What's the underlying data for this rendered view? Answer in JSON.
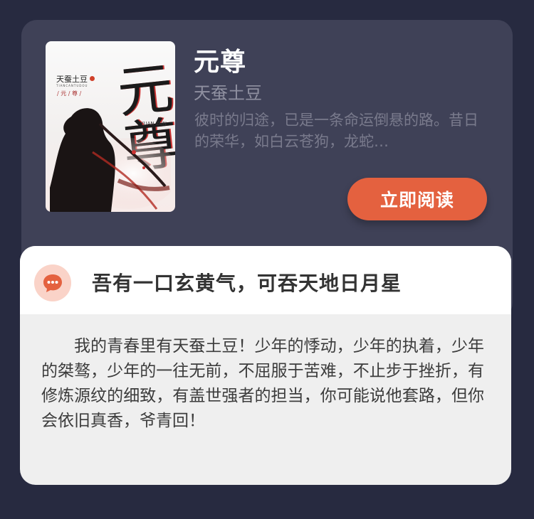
{
  "book": {
    "title": "元尊",
    "author": "天蚕土豆",
    "description": "彼时的归途，已是一条命运倒悬的路。昔日的荣华，如白云苍狗，龙蛇…",
    "read_button": "立即阅读",
    "cover": {
      "author": "天蚕土豆",
      "tag": "/ 元 / 尊 /",
      "calligraphy": "元尊",
      "pinyin": "YUAN ZUN",
      "subtitle": "TIANCANTUDOU"
    }
  },
  "comment": {
    "icon": "chat-bubble-icon",
    "title": "吾有一口玄黄气，可吞天地日月星",
    "body": "我的青春里有天蚕土豆！少年的悸动，少年的执着，少年的桀骜，少年的一往无前，不屈服于苦难，不止步于挫折，有修炼源纹的细致，有盖世强者的担当，你可能说他套路，但你会依旧真香，爷青回！"
  },
  "colors": {
    "background": "#272a40",
    "card": "#3f4157",
    "accent": "#e4613f",
    "badge": "#fad3c8"
  }
}
